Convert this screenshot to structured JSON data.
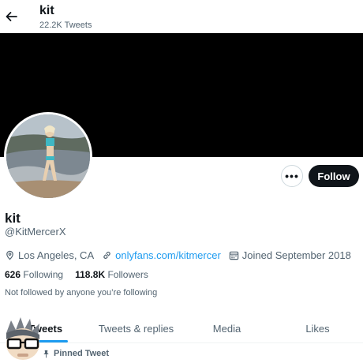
{
  "header": {
    "title": "kit",
    "tweet_count": "22.2K Tweets"
  },
  "profile": {
    "name": "kit",
    "handle": "@KitMercerX",
    "location": "Los Angeles, CA",
    "website": "onlyfans.com/kitmercer",
    "joined": "Joined September 2018",
    "following_count": "626",
    "following_label": "Following",
    "followers_count": "118.8K",
    "followers_label": "Followers",
    "followed_note": "Not followed by anyone you’re following"
  },
  "actions": {
    "more_label": "•••",
    "follow_label": "Follow"
  },
  "tabs": [
    {
      "label": "Tweets"
    },
    {
      "label": "Tweets & replies"
    },
    {
      "label": "Media"
    },
    {
      "label": "Likes"
    }
  ],
  "pinned": {
    "label": "Pinned Tweet"
  },
  "colors": {
    "accent": "#1d9bf0",
    "banner": "#000000",
    "text": "#0f1419",
    "muted": "#536471"
  },
  "icons": [
    "back-arrow-icon",
    "location-icon",
    "link-icon",
    "calendar-icon",
    "pin-icon"
  ]
}
